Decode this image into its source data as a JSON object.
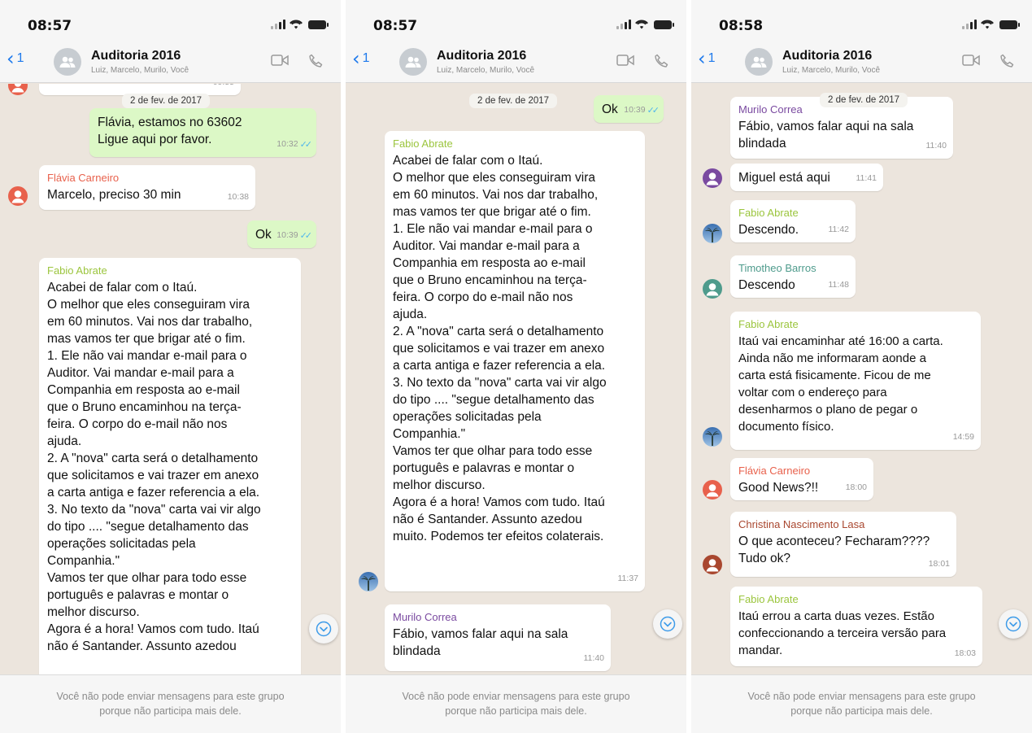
{
  "colors": {
    "chat_bg": "#ece5dd",
    "outgoing_bubble": "#dcf8c6",
    "incoming_bubble": "#ffffff",
    "link_blue": "#1f7aec",
    "read_check": "#4fb6ec",
    "sender_fabio": "#9bc53d",
    "sender_flavia": "#e8614c",
    "sender_murilo": "#7a4aa0",
    "sender_timotheo": "#4e9b8c",
    "sender_christina": "#a9472f"
  },
  "chat": {
    "title": "Auditoria 2016",
    "members": "Luiz, Marcelo, Murilo, Você",
    "back_count": "1",
    "video_icon": "video-call-icon",
    "phone_icon": "phone-call-icon",
    "footer_line1": "Você não pode enviar mensagens para este grupo",
    "footer_line2": "porque não participa mais dele."
  },
  "panels": [
    {
      "time": "08:57",
      "partial_time": "09:55",
      "date_chip": "2 de fev. de 2017",
      "messages": [
        {
          "text": "Flávia, estamos no 63602\nLigue aqui por favor.",
          "time": "10:32"
        },
        {
          "sender": "Flávia Carneiro",
          "text": "Marcelo, preciso 30 min",
          "time": "10:38"
        },
        {
          "text": "Ok",
          "time": "10:39"
        },
        {
          "sender": "Fabio Abrate",
          "text": "Acabei de falar com o Itaú.\nO melhor que eles conseguiram vira\nem 60 minutos. Vai nos dar trabalho,\nmas vamos ter que brigar até o fim.\n1. Ele não vai mandar e-mail para o\nAuditor. Vai mandar e-mail para a\nCompanhia em resposta ao e-mail\nque o Bruno encaminhou na terça-\nfeira. O corpo do e-mail não nos\najuda.\n2. A \"nova\" carta será o detalhamento\nque solicitamos e vai trazer em anexo\na carta antiga e fazer referencia a ela.\n3. No texto da \"nova\" carta vai vir algo\ndo tipo .... \"segue detalhamento das\noperações solicitadas pela\nCompanhia.\"\nVamos ter que olhar para todo esse\nportuguês e palavras e montar o\nmelhor discurso.\nAgora é a hora! Vamos com tudo. Itaú\nnão é Santander. Assunto azedou"
        }
      ]
    },
    {
      "time": "08:57",
      "date_chip": "2 de fev. de 2017",
      "messages": [
        {
          "text": "Ok",
          "time": "10:39"
        },
        {
          "sender": "Fabio Abrate",
          "text": "Acabei de falar com o Itaú.\nO melhor que eles conseguiram vira\nem 60 minutos. Vai nos dar trabalho,\nmas vamos ter que brigar até o fim.\n1. Ele não vai mandar e-mail para o\nAuditor. Vai mandar e-mail para a\nCompanhia em resposta ao e-mail\nque o Bruno encaminhou na terça-\nfeira. O corpo do e-mail não nos\najuda.\n2. A \"nova\" carta será o detalhamento\nque solicitamos e vai trazer em anexo\na carta antiga e fazer referencia a ela.\n3. No texto da \"nova\" carta vai vir algo\ndo tipo .... \"segue detalhamento das\noperações solicitadas pela\nCompanhia.\"\nVamos ter que olhar para todo esse\nportuguês e palavras e montar o\nmelhor discurso.\nAgora é a hora! Vamos com tudo. Itaú\nnão é Santander. Assunto azedou\nmuito. Podemos ter efeitos colaterais.",
          "time": "11:37"
        },
        {
          "sender": "Murilo Correa",
          "text": "Fábio, vamos falar aqui na sala\nblindada",
          "time": "11:40"
        }
      ]
    },
    {
      "time": "08:58",
      "date_chip": "2 de fev. de 2017",
      "messages": [
        {
          "sender": "Murilo Correa",
          "text": "Fábio, vamos falar aqui na sala\nblindada",
          "time": "11:40"
        },
        {
          "text": "Miguel está aqui",
          "time": "11:41"
        },
        {
          "sender": "Fabio Abrate",
          "text": "Descendo.",
          "time": "11:42"
        },
        {
          "sender": "Timotheo Barros",
          "text": "Descendo",
          "time": "11:48"
        },
        {
          "sender": "Fabio Abrate",
          "text": "Itaú vai encaminhar até 16:00 a carta.\nAinda não me informaram aonde a\ncarta está fisicamente. Ficou de me\nvoltar com o endereço para\ndesenharmos o plano de pegar o\ndocumento físico.",
          "time": "14:59"
        },
        {
          "sender": "Flávia Carneiro",
          "text": "Good News?!!",
          "time": "18:00"
        },
        {
          "sender": "Christina Nascimento Lasa",
          "text": "O que aconteceu? Fecharam????\nTudo ok?",
          "time": "18:01"
        },
        {
          "sender": "Fabio Abrate",
          "text": "Itaú errou a carta duas vezes. Estão\nconfeccionando a terceira versão para\nmandar.",
          "time": "18:03"
        }
      ]
    }
  ]
}
